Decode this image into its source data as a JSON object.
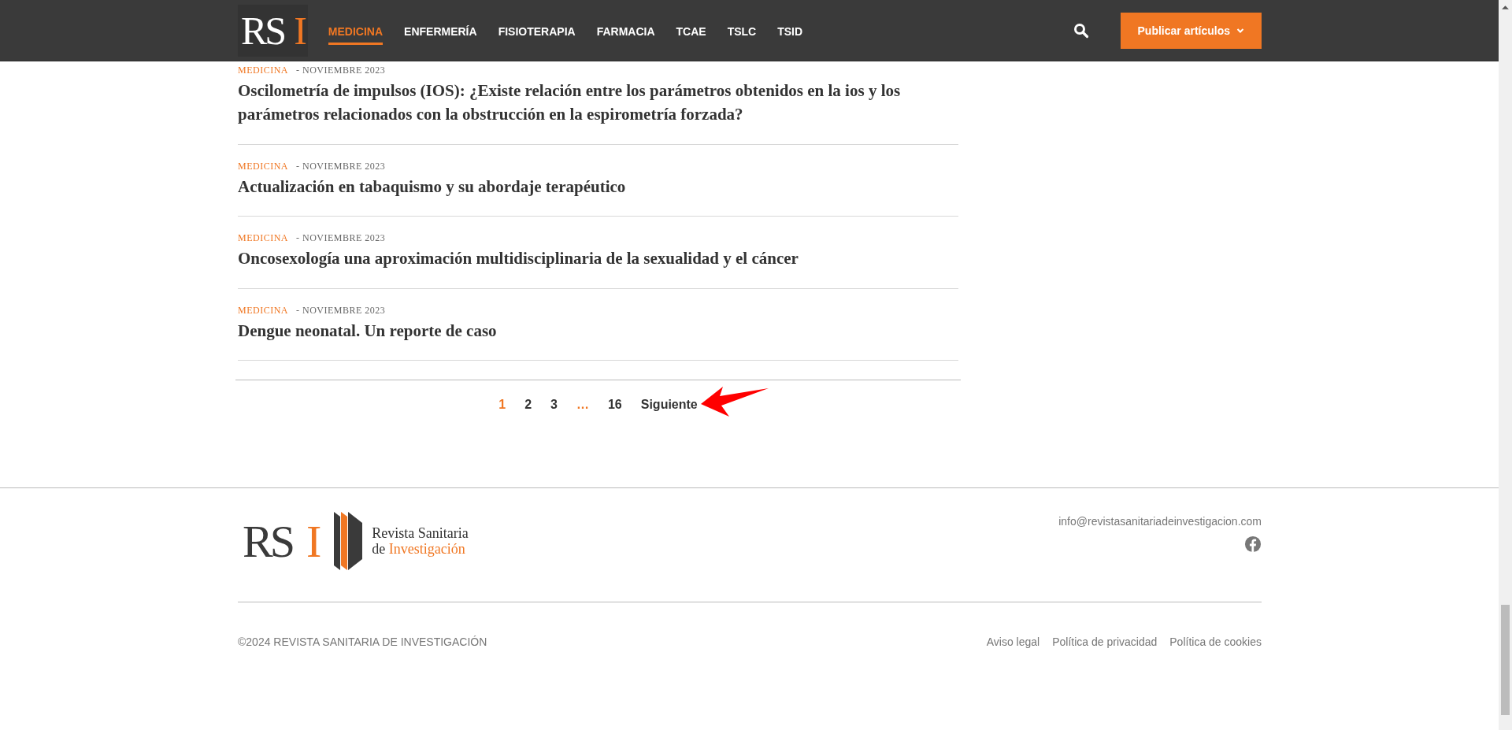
{
  "header": {
    "logo": {
      "letters": "RS",
      "accent": "I"
    },
    "nav": [
      {
        "label": "MEDICINA",
        "selected": true
      },
      {
        "label": "ENFERMERÍA",
        "selected": false
      },
      {
        "label": "FISIOTERAPIA",
        "selected": false
      },
      {
        "label": "FARMACIA",
        "selected": false
      },
      {
        "label": "TCAE",
        "selected": false
      },
      {
        "label": "TSLC",
        "selected": false
      },
      {
        "label": "TSID",
        "selected": false
      }
    ],
    "publish_button": "Publicar artículos"
  },
  "articles": [
    {
      "category": "MEDICINA",
      "date": "- NOVIEMBRE 2023",
      "title": "Oscilometría de impulsos (IOS): ¿Existe relación entre los parámetros obtenidos en la ios y los parámetros relacionados con la obstrucción en la espirometría forzada?"
    },
    {
      "category": "MEDICINA",
      "date": "- NOVIEMBRE 2023",
      "title": "Actualización en tabaquismo y su abordaje terapéutico"
    },
    {
      "category": "MEDICINA",
      "date": "- NOVIEMBRE 2023",
      "title": "Oncosexología una aproximación multidisciplinaria de la sexualidad y el cáncer"
    },
    {
      "category": "MEDICINA",
      "date": "- NOVIEMBRE 2023",
      "title": "Dengue neonatal. Un reporte de caso"
    }
  ],
  "pagination": {
    "items": [
      {
        "kind": "page",
        "label": "1",
        "selected": true
      },
      {
        "kind": "page",
        "label": "2",
        "selected": false
      },
      {
        "kind": "page",
        "label": "3",
        "selected": false
      },
      {
        "kind": "ellipsis",
        "label": "…"
      },
      {
        "kind": "page",
        "label": "16",
        "selected": false
      }
    ],
    "next": "Siguiente"
  },
  "footer": {
    "logo": {
      "letters": "RS",
      "accent": "I",
      "name_line1": "Revista Sanitaria",
      "name_line2_prefix": "de",
      "name_line2_accent": "Investigación"
    },
    "email": "info@revistasanitariadeinvestigacion.com",
    "copyright": "©2024 REVISTA SANITARIA DE INVESTIGACIÓN",
    "links": [
      "Aviso legal",
      "Política de privacidad",
      "Política de cookies"
    ]
  }
}
